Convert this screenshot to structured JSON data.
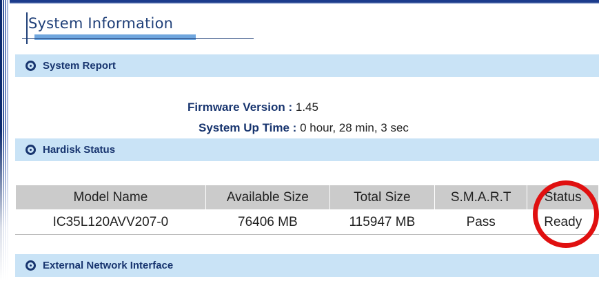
{
  "page": {
    "title": "System Information"
  },
  "sections": {
    "system_report": {
      "label": "System Report",
      "icon": "bullet-icon"
    },
    "hardisk_status": {
      "label": "Hardisk Status",
      "icon": "bullet-icon"
    },
    "external_network": {
      "label": "External Network Interface",
      "icon": "bullet-icon"
    }
  },
  "system_report": {
    "firmware_label": "Firmware Version :",
    "firmware_value": "1.45",
    "uptime_label": "System Up Time :",
    "uptime_value": "0 hour, 28 min, 3 sec"
  },
  "hardisk_table": {
    "columns": [
      "Model Name",
      "Available Size",
      "Total Size",
      "S.M.A.R.T",
      "Status"
    ],
    "rows": [
      [
        "IC35L120AVV207-0",
        "76406 MB",
        "115947 MB",
        "Pass",
        "Ready"
      ]
    ]
  },
  "colors": {
    "section_bar": "#c9e3f6",
    "title_text": "#1f3f78",
    "table_header": "#cbcbcb",
    "highlight_circle": "#e01010"
  }
}
